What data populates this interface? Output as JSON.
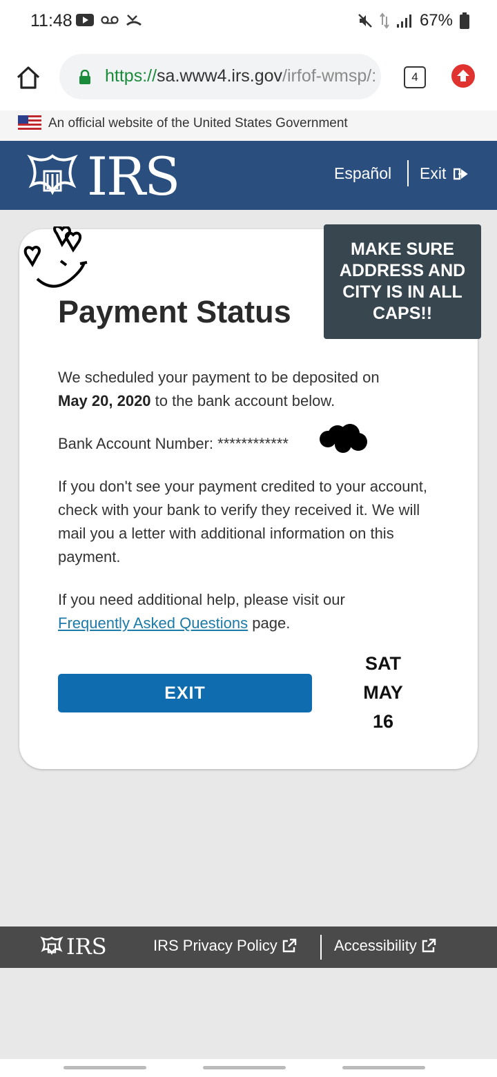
{
  "status_bar": {
    "time": "11:48",
    "battery": "67%"
  },
  "browser": {
    "url_scheme": "https://",
    "url_host": "sa.www4.irs.gov",
    "url_path": "/irfof-wmsp/:",
    "tab_count": "4"
  },
  "official_banner": "An official website of the United States Government",
  "header": {
    "brand": "IRS",
    "espanol": "Español",
    "exit": "Exit"
  },
  "card": {
    "title": "Payment Status",
    "p1_prefix": "We scheduled your payment to be deposited on",
    "p1_date": "May 20, 2020",
    "p1_suffix": "to the bank account below.",
    "account_label": "Bank Account Number:",
    "account_masked": "************",
    "p3": "If you don't see your payment credited to your account, check with your bank to verify they received it. We will mail you a letter with additional information on this payment.",
    "p4_prefix": "If you need additional help, please visit our",
    "faq_link": "Frequently Asked Questions",
    "p4_suffix": "page.",
    "exit_button": "EXIT"
  },
  "overlays": {
    "sticker_text": "MAKE SURE ADDRESS AND CITY IS IN ALL CAPS!!",
    "date_note_day": "SAT",
    "date_note_month": "MAY",
    "date_note_num": "16"
  },
  "footer": {
    "brand": "IRS",
    "privacy": "IRS Privacy Policy",
    "accessibility": "Accessibility"
  },
  "colors": {
    "header_bg": "#2a4f7f",
    "button_blue": "#0f6cae",
    "link": "#1b7aa8",
    "footer_bg": "#4a4a4a",
    "sticker_bg": "#384650"
  }
}
